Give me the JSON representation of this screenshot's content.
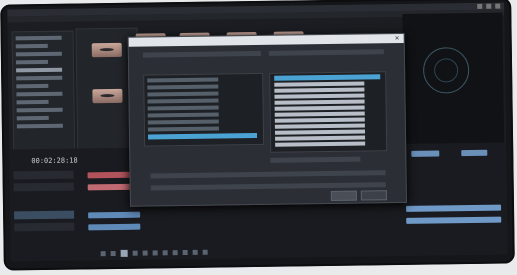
{
  "app": {
    "title": ""
  },
  "dialog": {
    "title": ""
  },
  "timecode": "00:02:28:18",
  "project_panel": {
    "row_count": 14
  },
  "colors": {
    "accent": "#4ba3d4",
    "clip_red": "#b2535c",
    "clip_blue": "#5f89b6"
  }
}
